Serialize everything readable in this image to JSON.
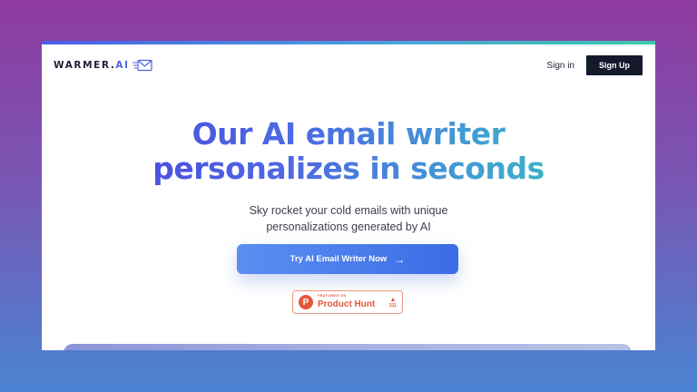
{
  "logo": {
    "brand": "WARMER.",
    "brand_accent": "AI",
    "icon": "envelope-icon"
  },
  "nav": {
    "signin_label": "Sign in",
    "signup_label": "Sign Up"
  },
  "hero": {
    "title_line1": "Our AI email writer",
    "title_line2": "personalizes in seconds",
    "subtitle_line1": "Sky rocket your cold emails with unique",
    "subtitle_line2": "personalizations generated by AI"
  },
  "cta": {
    "label": "Try AI Email Writer Now",
    "icon": "arrow-right-icon"
  },
  "product_hunt": {
    "logo_letter": "P",
    "featured_label": "FEATURED ON",
    "name": "Product Hunt",
    "upvote_icon": "upvote-triangle-icon",
    "votes": "311"
  },
  "colors": {
    "background_top": "#8e3aa0",
    "background_bottom": "#4a84d2",
    "accent_blue": "#4a63e0",
    "cta_blue": "#3c6ce5",
    "signup_dark": "#141a2b",
    "product_hunt_orange": "#e4573d"
  }
}
